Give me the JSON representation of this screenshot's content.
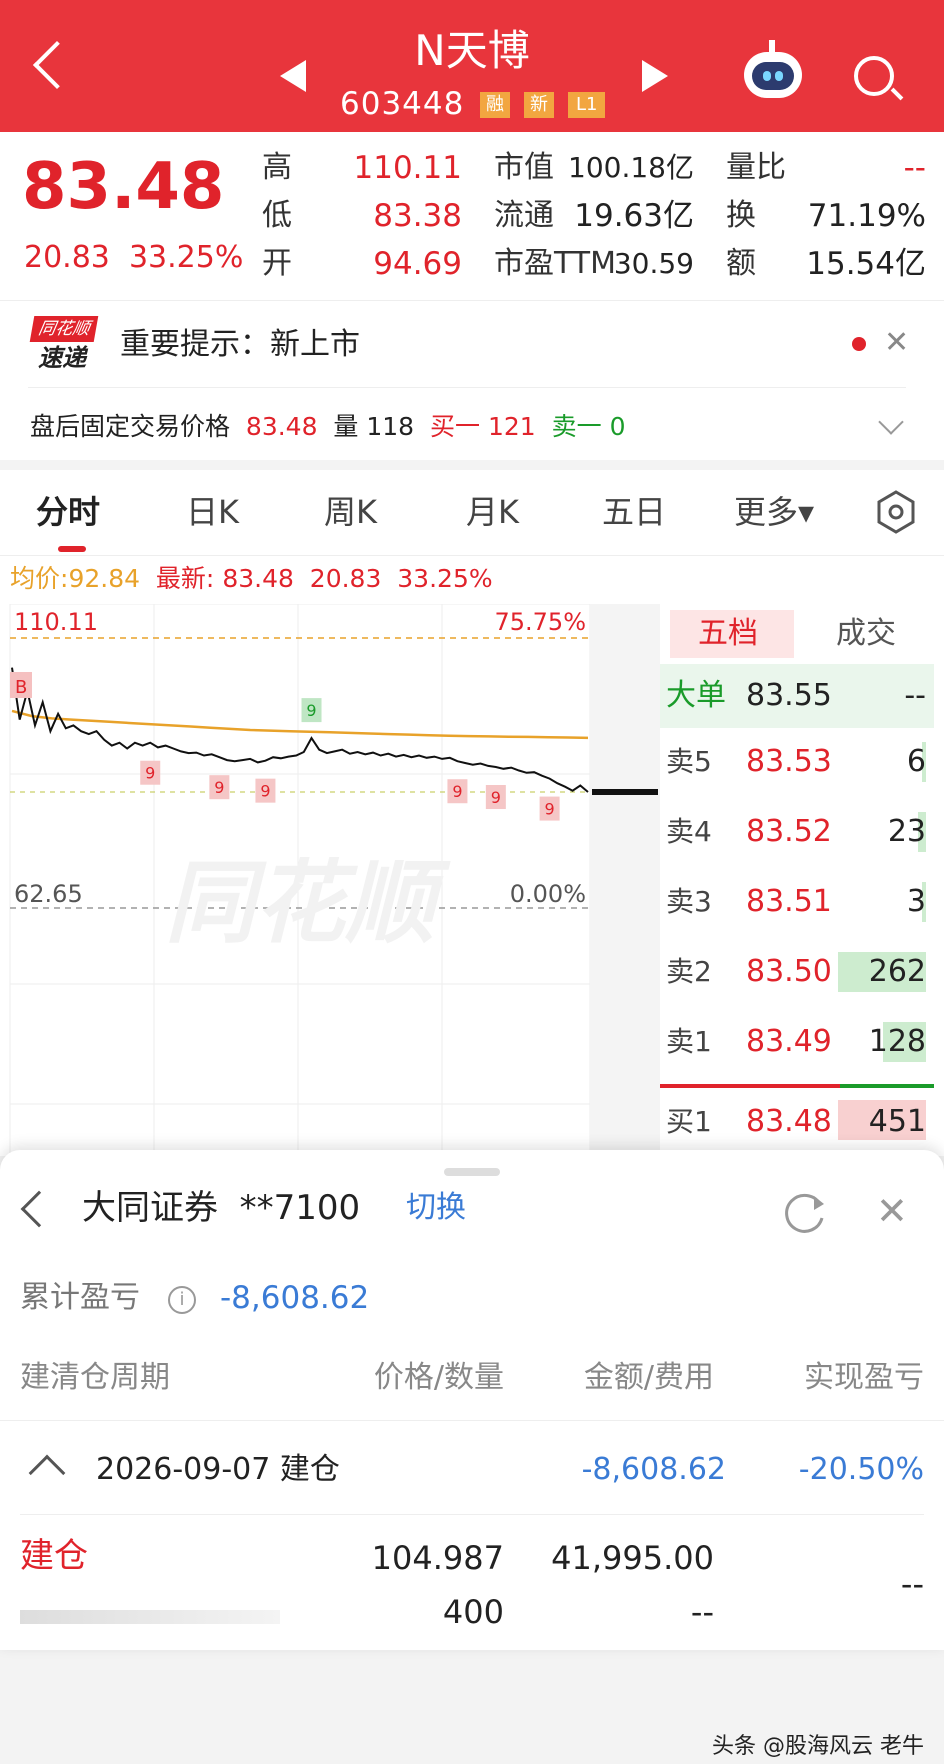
{
  "header": {
    "title": "N天博",
    "code": "603448",
    "tags": [
      "融",
      "新",
      "L1"
    ]
  },
  "quote": {
    "price": "83.48",
    "change": "20.83",
    "change_pct": "33.25%",
    "high_label": "高",
    "high": "110.11",
    "low_label": "低",
    "low": "83.38",
    "open_label": "开",
    "open": "94.69",
    "mktcap_label": "市值",
    "mktcap": "100.18亿",
    "float_label": "流通",
    "float": "19.63亿",
    "pe_label": "市盈TTM",
    "pe": "30.59",
    "vr_label": "量比",
    "vr": "--",
    "turnover_label": "换",
    "turnover": "71.19%",
    "amount_label": "额",
    "amount": "15.54亿"
  },
  "notice": {
    "logo_top": "同花顺",
    "logo_bottom": "速递",
    "text": "重要提示：新上市",
    "after_label": "盘后固定交易价格",
    "after_price": "83.48",
    "vol_label": "量",
    "vol": "118",
    "buy1_label": "买一",
    "buy1": "121",
    "sell1_label": "卖一",
    "sell1": "0"
  },
  "tabs": [
    "分时",
    "日K",
    "周K",
    "月K",
    "五日",
    "更多▾"
  ],
  "chart_info": {
    "avg_label": "均价:",
    "avg": "92.84",
    "latest_label": "最新:",
    "latest": "83.48",
    "latest_change": "20.83",
    "latest_pct": "33.25%",
    "top_price": "110.11",
    "top_pct": "75.75%",
    "bottom_price": "62.65",
    "bottom_pct": "0.00%",
    "watermark": "同花顺",
    "b_marker": "B",
    "nine_marker": "9"
  },
  "chart_data": {
    "type": "line",
    "ylim": [
      62.65,
      110.11
    ],
    "series": [
      {
        "values": [
          105,
          96,
          101,
          95,
          99,
          94,
          97,
          94.5,
          95,
          94,
          93.5,
          94,
          92.5,
          91.5,
          92,
          91,
          92,
          91.5,
          92,
          91.2,
          91.5,
          91,
          90.5,
          90.2,
          90.3,
          89.8,
          90,
          89.5,
          89,
          88.8,
          89,
          89.2,
          88.6,
          88.9,
          89.5,
          89.3,
          89.6,
          89.8,
          90.4,
          92.8,
          90.8,
          90.2,
          90.5,
          90.8,
          90.1,
          90.4,
          90,
          90.3,
          89.8,
          90.1,
          89.6,
          89.9,
          89.5,
          89.8,
          89.4,
          89.6,
          89.2,
          89.4,
          88.8,
          88.5,
          88.2,
          88.4,
          88,
          87.8,
          87.5,
          87.7,
          87.2,
          86.8,
          86.9,
          86.3,
          85.8,
          85,
          84.4,
          83.7,
          84.6,
          83.48
        ]
      },
      {
        "values": [
          97.5,
          96.6,
          96.2,
          96,
          95.8,
          95.6,
          95.4,
          95.2,
          95,
          94.8,
          94.6,
          94.4,
          94.2,
          94.1,
          94,
          93.9,
          93.8,
          93.7,
          93.6,
          93.5,
          93.4,
          93.3,
          93.2,
          93.15,
          93.1,
          93.05,
          93,
          92.95,
          92.9,
          92.84
        ]
      }
    ]
  },
  "order_book": {
    "tab_active": "五档",
    "tab_other": "成交",
    "big_label": "大单",
    "big_price": "83.55",
    "big_vol": "--",
    "sells": [
      {
        "label": "卖5",
        "price": "83.53",
        "vol": "6"
      },
      {
        "label": "卖4",
        "price": "83.52",
        "vol": "23"
      },
      {
        "label": "卖3",
        "price": "83.51",
        "vol": "3"
      },
      {
        "label": "卖2",
        "price": "83.50",
        "vol": "262"
      },
      {
        "label": "卖1",
        "price": "83.49",
        "vol": "128"
      }
    ],
    "buy1": {
      "label": "买1",
      "price": "83.48",
      "vol": "451"
    }
  },
  "panel": {
    "broker": "大同证券",
    "account": "**7100",
    "switch": "切换",
    "pnl_label": "累计盈亏",
    "pnl": "-8,608.62",
    "cols": [
      "建清仓周期",
      "价格/数量",
      "金额/费用",
      "实现盈亏"
    ],
    "period": "2026-09-07 建仓",
    "period_amount": "-8,608.62",
    "period_pct": "-20.50%",
    "row_type": "建仓",
    "row_price": "104.987",
    "row_qty": "400",
    "row_amount": "41,995.00",
    "row_fee": "--",
    "row_pnl": "--"
  },
  "footer": "头条 @股海风云 老牛",
  "colors": {
    "brand": "#e8353c",
    "up": "#e0232b",
    "down": "#1a9b2a",
    "avg_line": "#e8a22a",
    "link": "#3a7bd5"
  }
}
